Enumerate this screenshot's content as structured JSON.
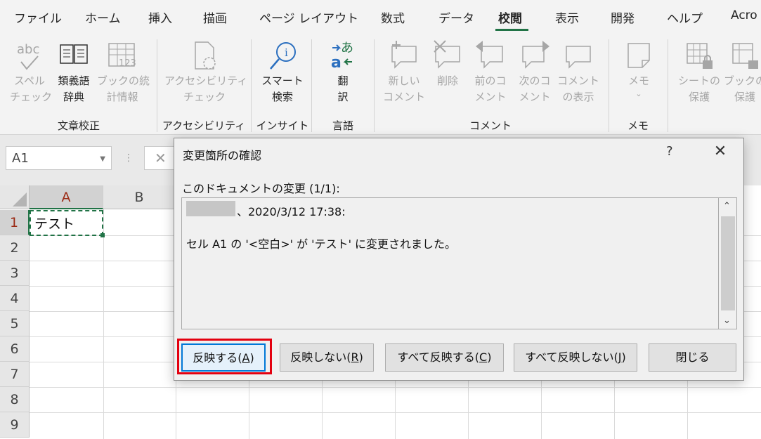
{
  "menu": {
    "tabs": [
      "ファイル",
      "ホーム",
      "挿入",
      "描画",
      "ページ レイアウト",
      "数式",
      "データ",
      "校閲",
      "表示",
      "開発",
      "ヘルプ",
      "Acro"
    ],
    "active_tab": "校閲"
  },
  "ribbon": {
    "groups": {
      "proofing": "文章校正",
      "accessibility": "アクセシビリティ",
      "insights": "インサイト",
      "language": "言語",
      "comments": "コメント",
      "notes": "メモ"
    },
    "buttons": {
      "spell_1": "スペル",
      "spell_2": "チェック",
      "thesaurus_1": "類義語",
      "thesaurus_2": "辞典",
      "stats_1": "ブックの統",
      "stats_2": "計情報",
      "access_1": "アクセシビリティ",
      "access_2": "チェック",
      "smart_1": "スマート",
      "smart_2": "検索",
      "translate_1": "翻",
      "translate_2": "訳",
      "newc_1": "新しい",
      "newc_2": "コメント",
      "delete": "削除",
      "prev_1": "前のコ",
      "prev_2": "メント",
      "next_1": "次のコ",
      "next_2": "メント",
      "show_1": "コメント",
      "show_2": "の表示",
      "memo": "メモ",
      "protect_sheet_1": "シートの",
      "protect_sheet_2": "保護",
      "protect_book_1": "ブックの",
      "protect_book_2": "保護"
    }
  },
  "formula_bar": {
    "name_box": "A1"
  },
  "sheet": {
    "columns": [
      "A",
      "B"
    ],
    "rows": [
      "1",
      "2",
      "3",
      "4",
      "5",
      "6",
      "7",
      "8",
      "9"
    ],
    "a1_value": "テスト"
  },
  "dialog": {
    "title": "変更箇所の確認",
    "help": "?",
    "heading": "このドキュメントの変更 (1/1):",
    "line1": "、2020/3/12 17:38:",
    "line2": "セル A1 の '<空白>' が 'テスト' に変更されました。",
    "buttons": {
      "accept": "反映する(",
      "accept_key": "A",
      "reject": "反映しない(",
      "reject_key": "R",
      "accept_all": "すべて反映する(",
      "accept_all_key": "C",
      "reject_all": "すべて反映しない(",
      "reject_all_key": "J",
      "close": "閉じる",
      "suffix": ")"
    }
  }
}
